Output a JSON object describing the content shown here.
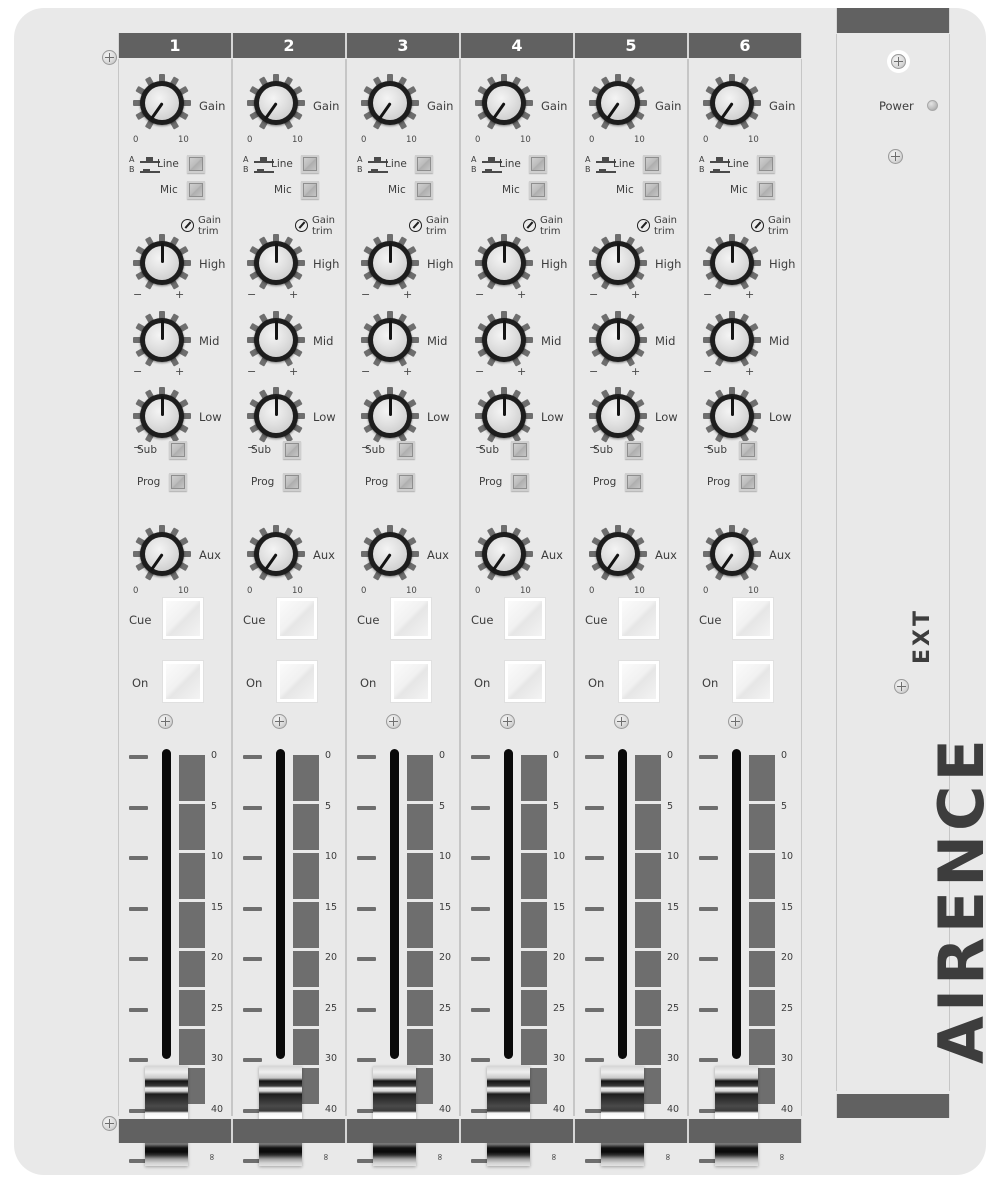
{
  "device": {
    "brand": "AIRENCE",
    "model_suffix": "EXT",
    "power_label": "Power"
  },
  "channels": [
    {
      "number": "1"
    },
    {
      "number": "2"
    },
    {
      "number": "3"
    },
    {
      "number": "4"
    },
    {
      "number": "5"
    },
    {
      "number": "6"
    }
  ],
  "controls": {
    "gain": {
      "label": "Gain",
      "min": "0",
      "max": "10"
    },
    "input_select": {
      "a": "A",
      "b": "B",
      "line": "Line",
      "mic": "Mic"
    },
    "gain_trim": {
      "line1": "Gain",
      "line2": "trim"
    },
    "eq": [
      {
        "label": "High",
        "min": "−",
        "max": "+"
      },
      {
        "label": "Mid",
        "min": "−",
        "max": "+"
      },
      {
        "label": "Low",
        "min": "−",
        "max": "+"
      }
    ],
    "bus": [
      {
        "label": "Sub"
      },
      {
        "label": "Prog"
      }
    ],
    "aux": {
      "label": "Aux",
      "min": "0",
      "max": "10"
    },
    "cue": {
      "label": "Cue"
    },
    "on": {
      "label": "On"
    },
    "fader": {
      "scale": [
        "0",
        "5",
        "10",
        "15",
        "20",
        "25",
        "30",
        "40",
        "∞"
      ]
    }
  },
  "colors": {
    "panel": "#e9e9e9",
    "header_bar": "#616161",
    "meter_block": "#6e6e6e",
    "knob_cap": "#1d1d1d",
    "text": "#3d3d3d",
    "fader_track": "#0a0a0a"
  }
}
